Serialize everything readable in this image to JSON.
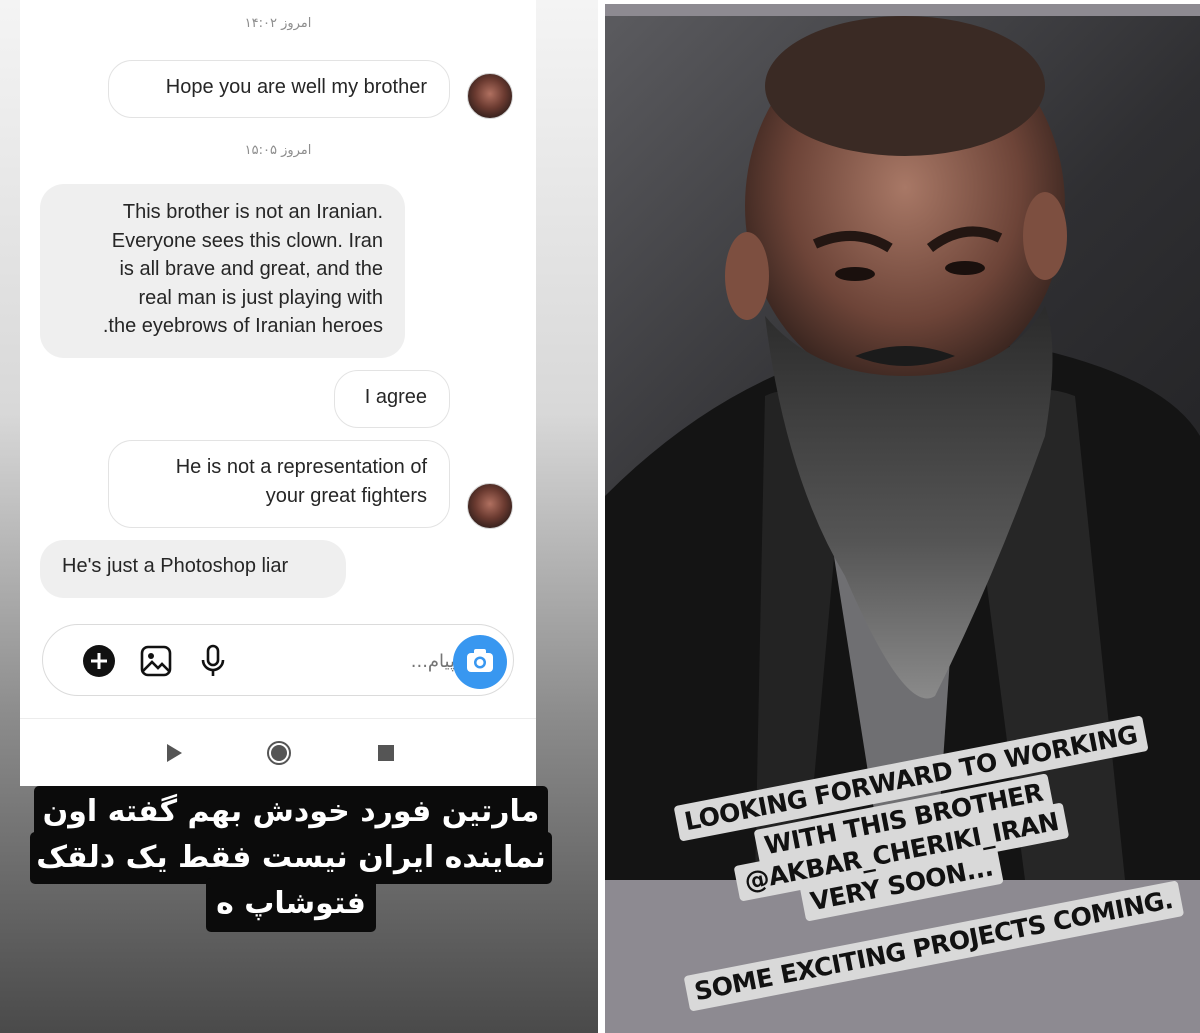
{
  "chat": {
    "timestamps": [
      "امروز ۱۴:۰۲",
      "امروز ۱۵:۰۵"
    ],
    "messages": [
      {
        "direction": "sent",
        "text": "Hope you are well my brother"
      },
      {
        "direction": "received",
        "lines": [
          "This brother is not an Iranian.",
          "Everyone sees this clown. Iran",
          "is all brave and great, and the",
          "real man is just playing with",
          ".the eyebrows of Iranian heroes"
        ]
      },
      {
        "direction": "sent",
        "text": "I agree"
      },
      {
        "direction": "sent",
        "lines": [
          "He is not a representation of",
          "your great fighters"
        ]
      },
      {
        "direction": "received",
        "text": "He's just a Photoshop liar"
      }
    ],
    "composer": {
      "placeholder": "پیام...",
      "icons": [
        "plus-icon",
        "gallery-icon",
        "microphone-icon",
        "camera-icon"
      ]
    },
    "nav_icons": [
      "back-icon",
      "home-icon",
      "recents-icon"
    ]
  },
  "persian_caption": {
    "lines": [
      "مارتین فورد خودش بهم گفته اون",
      "نماینده ایران نیست فقط یک دلقک",
      "فتوشاپ ه"
    ]
  },
  "story_caption": {
    "lines": [
      "LOOKING FORWARD TO WORKING",
      "WITH THIS BROTHER",
      "@AKBAR_CHERIKI_IRAN",
      "VERY SOON...",
      "SOME EXCITING PROJECTS COMING."
    ]
  },
  "colors": {
    "accent": "#3897f0",
    "received_bubble": "#efefef",
    "caption_black": "#0b0b0b",
    "caption_light": "#d9d9d9"
  }
}
